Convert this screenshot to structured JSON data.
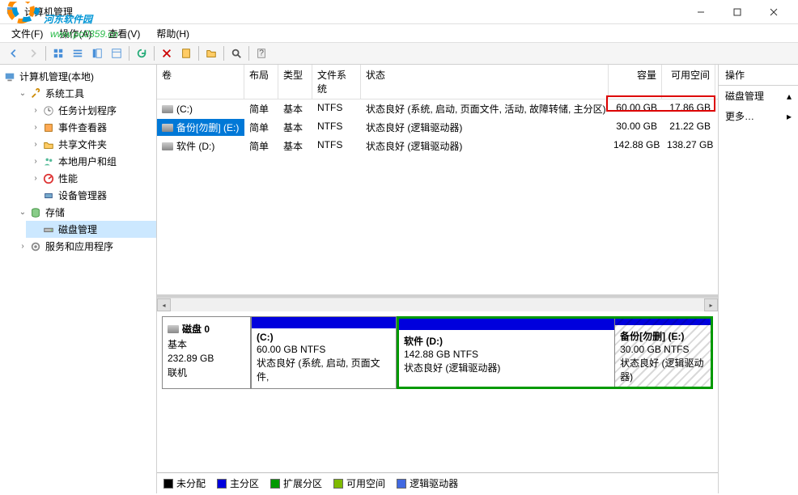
{
  "window": {
    "title": "计算机管理"
  },
  "watermark": {
    "line1": "河东软件园",
    "line2": "www.pc0359.cn"
  },
  "menu": {
    "file": "文件(F)",
    "action": "操作(A)",
    "view": "查看(V)",
    "help": "帮助(H)"
  },
  "tree": {
    "root": "计算机管理(本地)",
    "sys_tools": "系统工具",
    "task_sched": "任务计划程序",
    "event_viewer": "事件查看器",
    "shared": "共享文件夹",
    "users": "本地用户和组",
    "perf": "性能",
    "devmgr": "设备管理器",
    "storage": "存储",
    "diskmgmt": "磁盘管理",
    "svc": "服务和应用程序"
  },
  "columns": {
    "volume": "卷",
    "layout": "布局",
    "type": "类型",
    "fs": "文件系统",
    "status": "状态",
    "capacity": "容量",
    "free": "可用空间"
  },
  "volumes": [
    {
      "name": "(C:)",
      "layout": "简单",
      "type": "基本",
      "fs": "NTFS",
      "status": "状态良好 (系统, 启动, 页面文件, 活动, 故障转储, 主分区)",
      "capacity": "60.00 GB",
      "free": "17.86 GB",
      "selected": false
    },
    {
      "name": "备份[勿删] (E:)",
      "layout": "简单",
      "type": "基本",
      "fs": "NTFS",
      "status": "状态良好 (逻辑驱动器)",
      "capacity": "30.00 GB",
      "free": "21.22 GB",
      "selected": true
    },
    {
      "name": "软件 (D:)",
      "layout": "简单",
      "type": "基本",
      "fs": "NTFS",
      "status": "状态良好 (逻辑驱动器)",
      "capacity": "142.88 GB",
      "free": "138.27 GB",
      "selected": false
    }
  ],
  "disk": {
    "label": "磁盘 0",
    "type": "基本",
    "size": "232.89 GB",
    "state": "联机",
    "partitions": [
      {
        "title": "(C:)",
        "size": "60.00 GB NTFS",
        "status": "状态良好 (系统, 启动, 页面文件,"
      },
      {
        "title": "软件   (D:)",
        "size": "142.88 GB NTFS",
        "status": "状态良好 (逻辑驱动器)"
      },
      {
        "title": "备份[勿删]   (E:)",
        "size": "30.00 GB NTFS",
        "status": "状态良好 (逻辑驱动器)"
      }
    ]
  },
  "legend": {
    "unalloc": "未分配",
    "primary": "主分区",
    "ext": "扩展分区",
    "free": "可用空间",
    "logical": "逻辑驱动器"
  },
  "actions": {
    "header": "操作",
    "diskmgmt": "磁盘管理",
    "more": "更多…"
  }
}
